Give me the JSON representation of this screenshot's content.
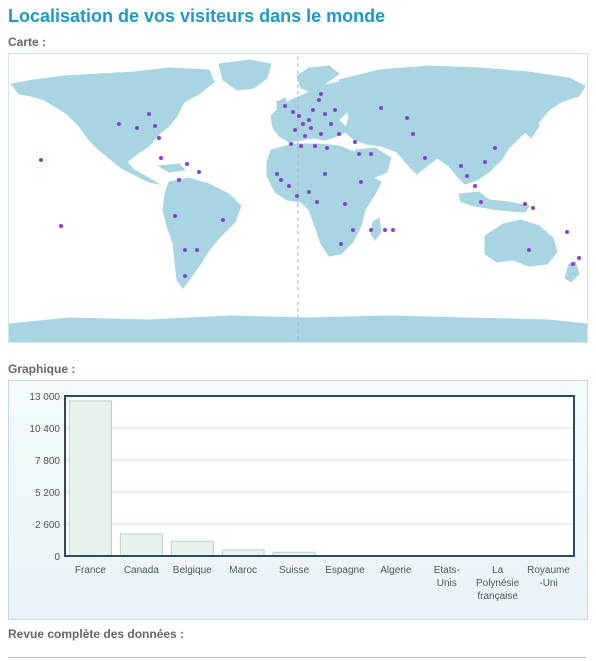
{
  "page": {
    "title": "Localisation de vos visiteurs dans le monde"
  },
  "map_section": {
    "label": "Carte :"
  },
  "chart_section": {
    "label": "Graphique :"
  },
  "review_section": {
    "label": "Revue complète des données :"
  },
  "colors": {
    "accent": "#1a9bc9",
    "land": "#a8d5e2",
    "marker": "#8a3fd9",
    "bar_fill": "#e6f2ea",
    "bar_edge": "#b8d4c4"
  },
  "map_markers_icon": "visitor-marker-icon",
  "chart_data": {
    "type": "bar",
    "title": "",
    "xlabel": "",
    "ylabel": "",
    "categories": [
      [
        "France"
      ],
      [
        "Canada"
      ],
      [
        "Belgique"
      ],
      [
        "Maroc"
      ],
      [
        "Suisse"
      ],
      [
        "Espagne"
      ],
      [
        "Algerie"
      ],
      [
        "Etats-",
        "Unis"
      ],
      [
        "La",
        "Polynésie",
        "française"
      ],
      [
        "Royaume",
        "-Uni"
      ]
    ],
    "values": [
      12600,
      1800,
      1200,
      500,
      300,
      30,
      20,
      15,
      10,
      10
    ],
    "ylim": [
      0,
      13000
    ],
    "yticks": [
      0,
      2600,
      5200,
      7800,
      10400,
      13000
    ],
    "ytick_labels": [
      "0",
      "2 600",
      "5 200",
      "7 800",
      "10 400",
      "13 000"
    ],
    "grid": true
  }
}
